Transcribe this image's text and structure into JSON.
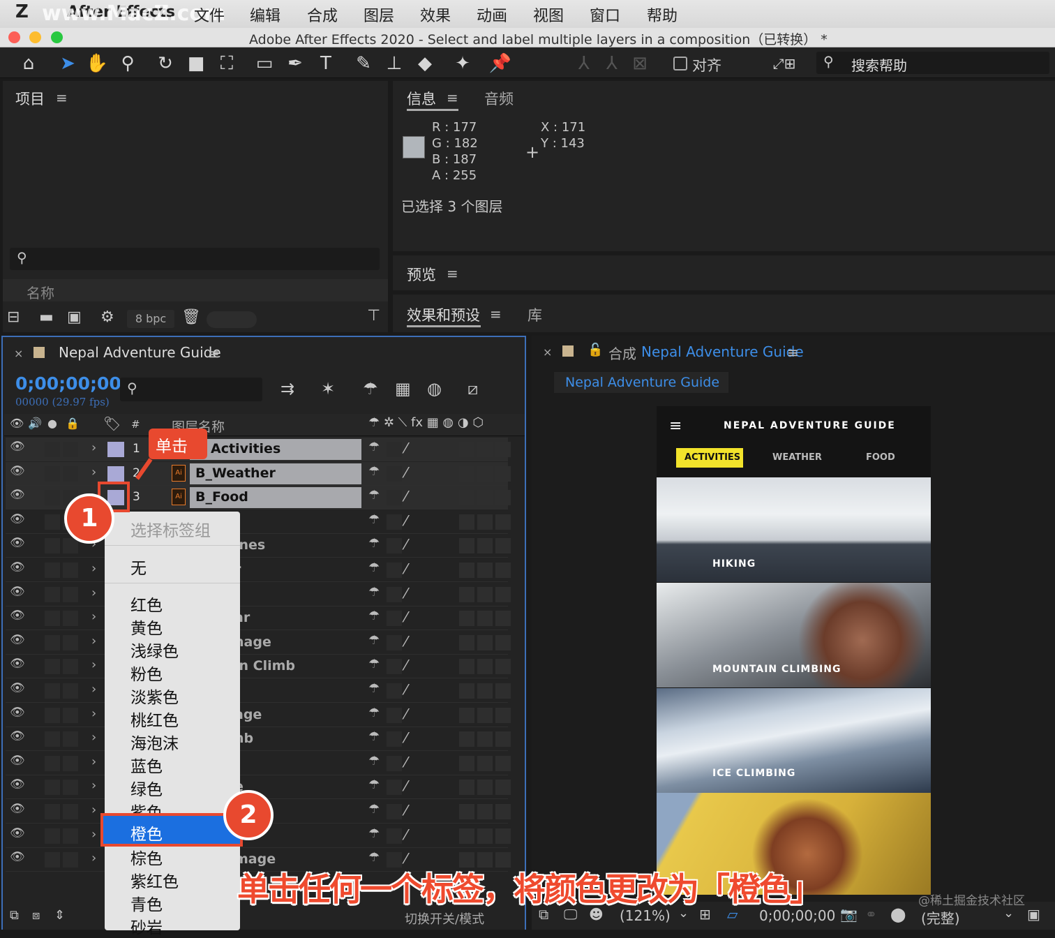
{
  "menubar": {
    "app": "After Effects",
    "items": [
      "文件",
      "编辑",
      "合成",
      "图层",
      "效果",
      "动画",
      "视图",
      "窗口",
      "帮助"
    ],
    "watermark": "www.MacZ.com"
  },
  "window": {
    "title": "Adobe After Effects 2020 - Select and label multiple layers in a composition（已转换） *"
  },
  "toolbar": {
    "align_label": "对齐",
    "search_help": "搜索帮助"
  },
  "project": {
    "title": "项目",
    "col_name": "名称",
    "bpc": "8 bpc"
  },
  "info": {
    "tab_info": "信息",
    "tab_audio": "音频",
    "r": "R :  177",
    "g": "G :  182",
    "b": "B :  187",
    "a": "A :  255",
    "x": "X :  171",
    "y": "Y :  143",
    "selected": "已选择 3 个图层"
  },
  "preview": {
    "title": "预览"
  },
  "effects": {
    "title": "效果和预设",
    "library": "库"
  },
  "timeline": {
    "comp_name": "Nepal Adventure Guide",
    "timecode": "0;00;00;00",
    "frames": "00000 (29.97 fps)",
    "col_layer_name": "图层名称",
    "footer": "切换开关/模式",
    "layers": [
      {
        "num": "1",
        "name": "Activities"
      },
      {
        "num": "2",
        "name": "B_Weather"
      },
      {
        "num": "3",
        "name": "B_Food"
      },
      {
        "num": "",
        "name": ""
      },
      {
        "num": "",
        "name": "ines"
      },
      {
        "num": "",
        "name": "r"
      },
      {
        "num": "",
        "name": ""
      },
      {
        "num": "",
        "name": "ar"
      },
      {
        "num": "",
        "name": "nage"
      },
      {
        "num": "",
        "name": "in Climb"
      },
      {
        "num": "",
        "name": ""
      },
      {
        "num": "",
        "name": "age"
      },
      {
        "num": "",
        "name": "nb"
      },
      {
        "num": "",
        "name": ""
      },
      {
        "num": "",
        "name": "e"
      },
      {
        "num": "",
        "name": ""
      },
      {
        "num": "",
        "name": "n"
      },
      {
        "num": "",
        "name": "mage"
      }
    ]
  },
  "label_menu": {
    "title": "选择标签组",
    "items": [
      "无",
      "红色",
      "黄色",
      "浅绿色",
      "粉色",
      "淡紫色",
      "桃红色",
      "海泡沫",
      "蓝色",
      "绿色",
      "紫色",
      "橙色",
      "棕色",
      "紫红色",
      "青色",
      "砂岩"
    ],
    "selected": "橙色"
  },
  "comp_viewer": {
    "prefix": "合成",
    "name": "Nepal Adventure Guide",
    "tab": "Nepal Adventure Guide",
    "zoom": "(121%)",
    "timecode": "0;00;00;00",
    "quality": "(完整)"
  },
  "app_screen": {
    "title": "NEPAL ADVENTURE GUIDE",
    "tabs": [
      "ACTIVITIES",
      "WEATHER",
      "FOOD"
    ],
    "cards": [
      "HIKING",
      "MOUNTAIN CLIMBING",
      "ICE CLIMBING"
    ]
  },
  "annotations": {
    "click": "单击",
    "step1": "1",
    "step2": "2",
    "caption": "单击任何一个标签，将颜色更改为「橙色」",
    "credit": "@稀土掘金技术社区"
  },
  "colors": {
    "accent": "#3d8ee8",
    "orange_highlight": "#1b6fe0",
    "callout": "#e8492f",
    "label_lavender": "#a9a9d6"
  }
}
